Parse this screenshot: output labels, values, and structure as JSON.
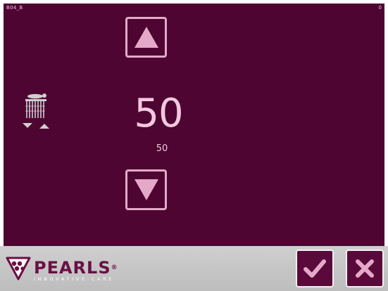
{
  "screen": {
    "code": "B04_B",
    "counter": "0"
  },
  "setting": {
    "value": "50",
    "reference": "50"
  },
  "branding": {
    "name": "PEARLS",
    "registered": "®",
    "tagline": "INNOVATIVE CARE"
  },
  "icons": {
    "increase": "triangle-up-icon",
    "decrease": "triangle-down-icon",
    "parameter": "massage-needles-icon",
    "confirm": "checkmark-icon",
    "cancel": "close-icon"
  },
  "colors": {
    "screen_background": "#4e0532",
    "accent_pink": "#e4a9c8",
    "value_text": "#f2c8de",
    "footer_background": "#c8c8c8",
    "brand_text": "#6b0f45",
    "action_background": "#5a0a3a"
  }
}
